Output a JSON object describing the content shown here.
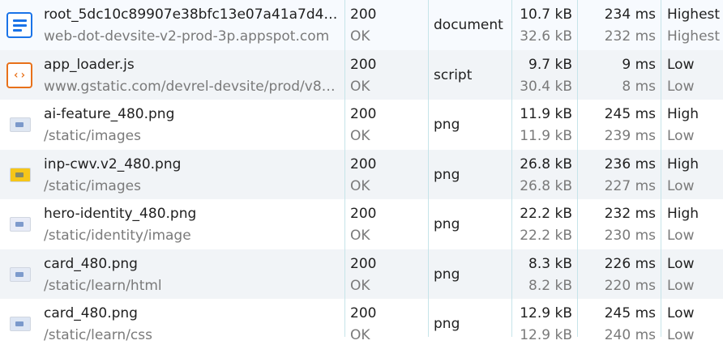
{
  "requests": [
    {
      "icon": "document-icon",
      "name": "root_5dc10c89907e38bfc13e07a41a7d479…",
      "path": "web-dot-devsite-v2-prod-3p.appspot.com",
      "status": "200",
      "status_text": "OK",
      "type": "document",
      "size": "10.7 kB",
      "resource_size": "32.6 kB",
      "time": "234 ms",
      "latency": "232 ms",
      "priority": "Highest",
      "initial_priority": "Highest"
    },
    {
      "icon": "script-icon",
      "name": "app_loader.js",
      "path": "www.gstatic.com/devrel-devsite/prod/v8e…",
      "status": "200",
      "status_text": "OK",
      "type": "script",
      "size": "9.7 kB",
      "resource_size": "30.4 kB",
      "time": "9 ms",
      "latency": "8 ms",
      "priority": "Low",
      "initial_priority": "Low"
    },
    {
      "icon": "image-thumbnail-icon",
      "name": "ai-feature_480.png",
      "path": "/static/images",
      "status": "200",
      "status_text": "OK",
      "type": "png",
      "size": "11.9 kB",
      "resource_size": "11.9 kB",
      "time": "245 ms",
      "latency": "239 ms",
      "priority": "High",
      "initial_priority": "Low",
      "thumb_color": "#dfe7f2"
    },
    {
      "icon": "image-thumbnail-icon",
      "name": "inp-cwv.v2_480.png",
      "path": "/static/images",
      "status": "200",
      "status_text": "OK",
      "type": "png",
      "size": "26.8 kB",
      "resource_size": "26.8 kB",
      "time": "236 ms",
      "latency": "227 ms",
      "priority": "High",
      "initial_priority": "Low",
      "thumb_color": "#f6c619"
    },
    {
      "icon": "image-thumbnail-icon",
      "name": "hero-identity_480.png",
      "path": "/static/identity/image",
      "status": "200",
      "status_text": "OK",
      "type": "png",
      "size": "22.2 kB",
      "resource_size": "22.2 kB",
      "time": "232 ms",
      "latency": "230 ms",
      "priority": "High",
      "initial_priority": "Low",
      "thumb_color": "#e9ecf7"
    },
    {
      "icon": "image-thumbnail-icon",
      "name": "card_480.png",
      "path": "/static/learn/html",
      "status": "200",
      "status_text": "OK",
      "type": "png",
      "size": "8.3 kB",
      "resource_size": "8.2 kB",
      "time": "226 ms",
      "latency": "220 ms",
      "priority": "Low",
      "initial_priority": "Low",
      "thumb_color": "#e4eaf5"
    },
    {
      "icon": "image-thumbnail-icon",
      "name": "card_480.png",
      "path": "/static/learn/css",
      "status": "200",
      "status_text": "OK",
      "type": "png",
      "size": "12.9 kB",
      "resource_size": "12.9 kB",
      "time": "245 ms",
      "latency": "240 ms",
      "priority": "Low",
      "initial_priority": "Low",
      "thumb_color": "#dde6f4"
    }
  ],
  "colors": {
    "document_icon": "#1a73e8",
    "script_icon": "#e8711a",
    "row_alt": "#f1f4f7",
    "grid_line": "#c6e4e9"
  }
}
